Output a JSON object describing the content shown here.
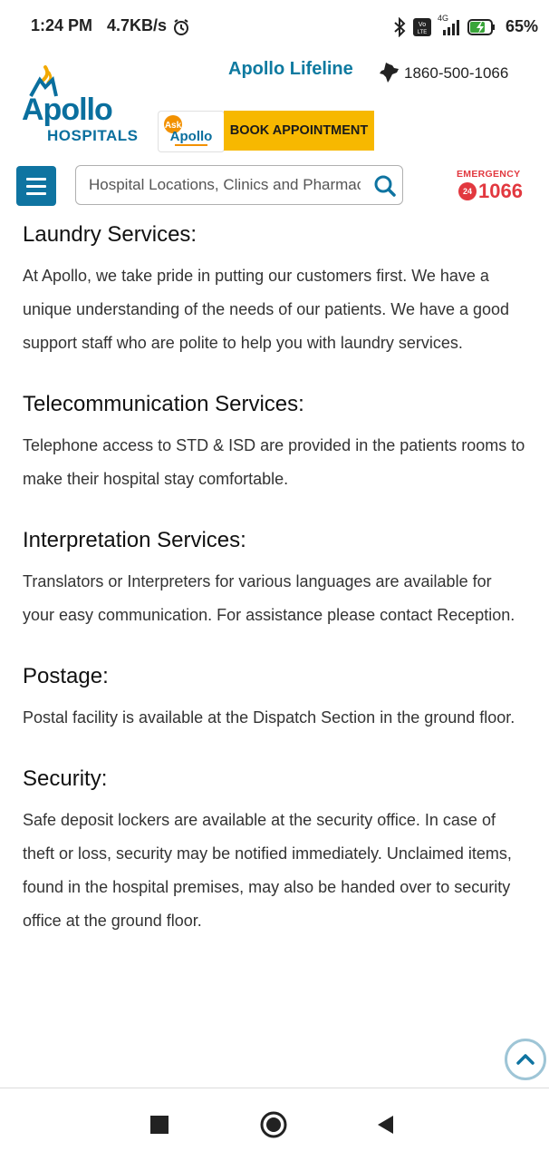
{
  "status_bar": {
    "time": "1:24 PM",
    "speed": "4.7KB/s",
    "network": "4G",
    "battery": "65%"
  },
  "header": {
    "logo_word": "Apollo",
    "logo_sub": "HOSPITALS",
    "lifeline": "Apollo Lifeline",
    "phone": "1860-500-1066",
    "ask_apollo": "Ask Apollo",
    "book_label": "BOOK APPOINTMENT",
    "search_placeholder": "Hospital Locations, Clinics and Pharmacies",
    "emergency_label": "EMERGENCY",
    "emergency_badge": "24",
    "emergency_number": "1066"
  },
  "sections": [
    {
      "title": "Laundry Services:",
      "body": "At Apollo, we take pride in putting our customers first. We have a unique understanding of the needs of our patients. We have a good support staff who are polite to help you with laundry services."
    },
    {
      "title": "Telecommunication Services:",
      "body": "Telephone access to STD & ISD are provided in the patients rooms to make their hospital stay comfortable."
    },
    {
      "title": "Interpretation Services:",
      "body": "Translators or Interpreters for various languages are available for your easy communication. For assistance please contact Reception."
    },
    {
      "title": "Postage:",
      "body": "Postal facility is available at the Dispatch Section in the ground floor."
    },
    {
      "title": "Security:",
      "body": "Safe deposit lockers are available at the security office. In case of theft or loss, security may be notified immediately. Unclaimed items, found in the hospital premises, may also be handed over to security office at the ground floor."
    }
  ],
  "colors": {
    "brand_blue": "#0f74a1",
    "book_yellow": "#f7b800",
    "emergency_red": "#e2383f"
  }
}
